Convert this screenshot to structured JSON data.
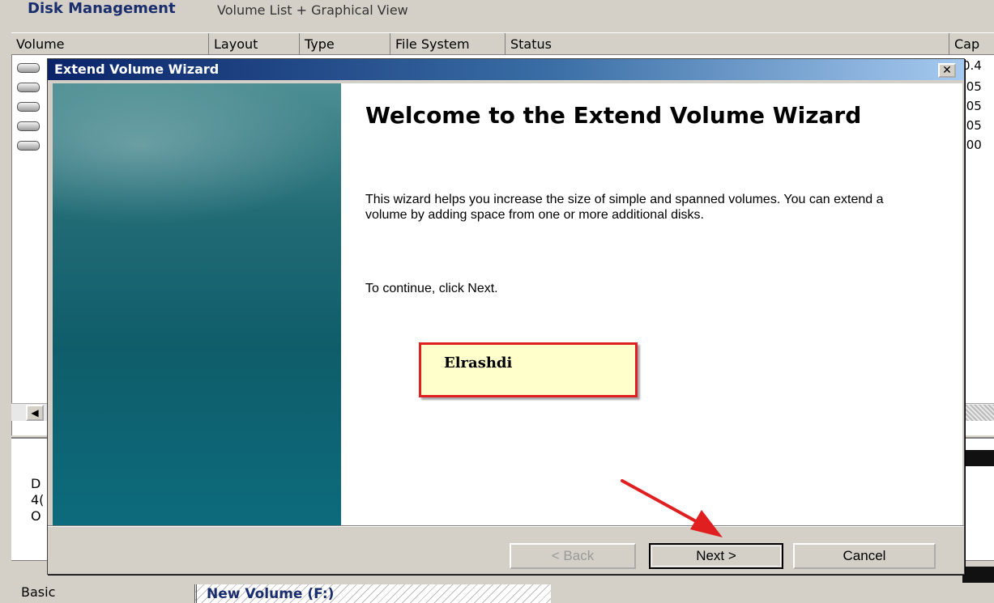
{
  "app": {
    "title": "Disk Management",
    "view": "Volume List + Graphical View"
  },
  "columns": [
    "Volume",
    "Layout",
    "Type",
    "File System",
    "Status",
    "Cap"
  ],
  "capacity_values": [
    "0.4",
    ".05",
    ".05",
    ".05",
    ".00"
  ],
  "graphical_view": {
    "disk_labels": [
      "D",
      "4(",
      "O"
    ],
    "basic_label": "Basic",
    "new_volume_label": "New Volume  (F:)"
  },
  "dialog": {
    "title": "Extend Volume Wizard",
    "close_glyph": "✕",
    "welcome_title": "Welcome to the Extend Volume Wizard",
    "body": "This wizard helps you increase the size of simple and spanned volumes. You can extend a volume  by adding space from one or more additional disks.",
    "continue_text": "To continue, click Next.",
    "annotation": "Elrashdi",
    "buttons": {
      "back": "< Back",
      "next": "Next >",
      "cancel": "Cancel"
    }
  },
  "colors": {
    "title_bar": "#0a246a",
    "arrow": "#e02020",
    "callout_bg": "#ffffcc"
  }
}
